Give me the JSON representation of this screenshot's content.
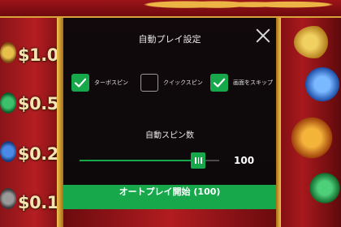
{
  "left_column": {
    "prizes": [
      "$1.0",
      "$0.5",
      "$0.2",
      "$0.1"
    ]
  },
  "autoplay_dialog": {
    "title": "自動プレイ設定",
    "options": [
      {
        "label": "ターボスピン",
        "checked": true
      },
      {
        "label": "クイックスピン",
        "checked": false
      },
      {
        "label": "画面をスキップ",
        "checked": true
      }
    ],
    "spin_count_label": "自動スピン数",
    "spin_count_value": "100",
    "spin_count_level": 0.85,
    "start_button_label": "オートプレイ開始 (100)"
  },
  "colors": {
    "accent": "#18a84c",
    "modal_bg": "#0a0a0c",
    "gold": "#f2c24d",
    "reel_red": "#b51e22"
  },
  "icons": [
    "close-icon",
    "checkmark-icon",
    "slider-grip-icon"
  ]
}
